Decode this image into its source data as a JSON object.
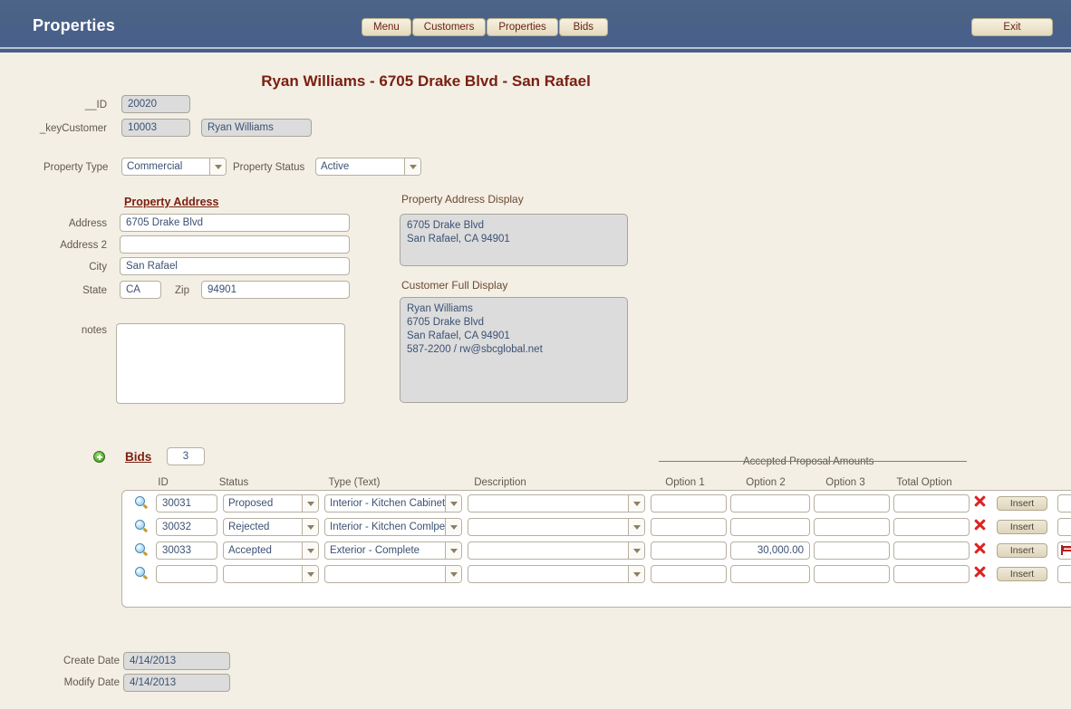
{
  "header": {
    "app_title": "Properties",
    "nav_buttons": [
      {
        "label": "Menu",
        "name": "menu"
      },
      {
        "label": "Customers",
        "name": "customers"
      },
      {
        "label": "Properties",
        "name": "properties"
      },
      {
        "label": "Bids",
        "name": "bids"
      }
    ],
    "exit_label": "Exit",
    "bar_color": "#4a6186",
    "button_text_color": "#6b1f14"
  },
  "page": {
    "title": "Ryan Williams - 6705 Drake Blvd - San Rafael",
    "title_color": "#7a2012"
  },
  "identity": {
    "id_label": "__ID",
    "id_value": "20020",
    "keycustomer_label": "_keyCustomer",
    "keycustomer_value": "10003",
    "customer_name": "Ryan Williams"
  },
  "classification": {
    "property_type_label": "Property Type",
    "property_type_value": "Commercial",
    "property_status_label": "Property Status",
    "property_status_value": "Active"
  },
  "address": {
    "section_title": "Property Address",
    "address_label": "Address",
    "address_value": "6705 Drake Blvd",
    "address2_label": "Address 2",
    "address2_value": "",
    "city_label": "City",
    "city_value": "San Rafael",
    "state_label": "State",
    "state_value": "CA",
    "zip_label": "Zip",
    "zip_value": "94901",
    "notes_label": "notes",
    "notes_value": ""
  },
  "displays": {
    "property_address_display_label": "Property Address Display",
    "property_address_display_value": "6705 Drake Blvd\nSan Rafael, CA  94901",
    "customer_full_display_label": "Customer Full Display",
    "customer_full_display_value": "Ryan Williams\n6705 Drake Blvd\nSan Rafael, CA  94901\n587-2200  /  rw@sbcglobal.net"
  },
  "bids": {
    "title": "Bids",
    "count": "3",
    "group_header": "Accepted Proposal Amounts",
    "columns": {
      "id": "ID",
      "status": "Status",
      "type": "Type (Text)",
      "description": "Description",
      "option1": "Option 1",
      "option2": "Option 2",
      "option3": "Option 3",
      "total_option": "Total Option"
    },
    "insert_label": "Insert",
    "rows": [
      {
        "id": "30031",
        "status": "Proposed",
        "type": "Interior - Kitchen Cabinets",
        "description": "",
        "option1": "",
        "option2": "",
        "option3": "",
        "total_option": "",
        "insert": "Insert",
        "has_flag": false
      },
      {
        "id": "30032",
        "status": "Rejected",
        "type": "Interior - Kitchen Comlpete",
        "description": "",
        "option1": "",
        "option2": "",
        "option3": "",
        "total_option": "",
        "insert": "Insert",
        "has_flag": false
      },
      {
        "id": "30033",
        "status": "Accepted",
        "type": "Exterior - Complete",
        "description": "",
        "option1": "",
        "option2": "30,000.00",
        "option3": "",
        "total_option": "",
        "insert": "Insert",
        "has_flag": true
      },
      {
        "id": "",
        "status": "",
        "type": "",
        "description": "",
        "option1": "",
        "option2": "",
        "option3": "",
        "total_option": "",
        "insert": "Insert",
        "has_flag": false
      }
    ]
  },
  "footer": {
    "create_date_label": "Create Date",
    "create_date_value": "4/14/2013",
    "modify_date_label": "Modify Date",
    "modify_date_value": "4/14/2013"
  }
}
